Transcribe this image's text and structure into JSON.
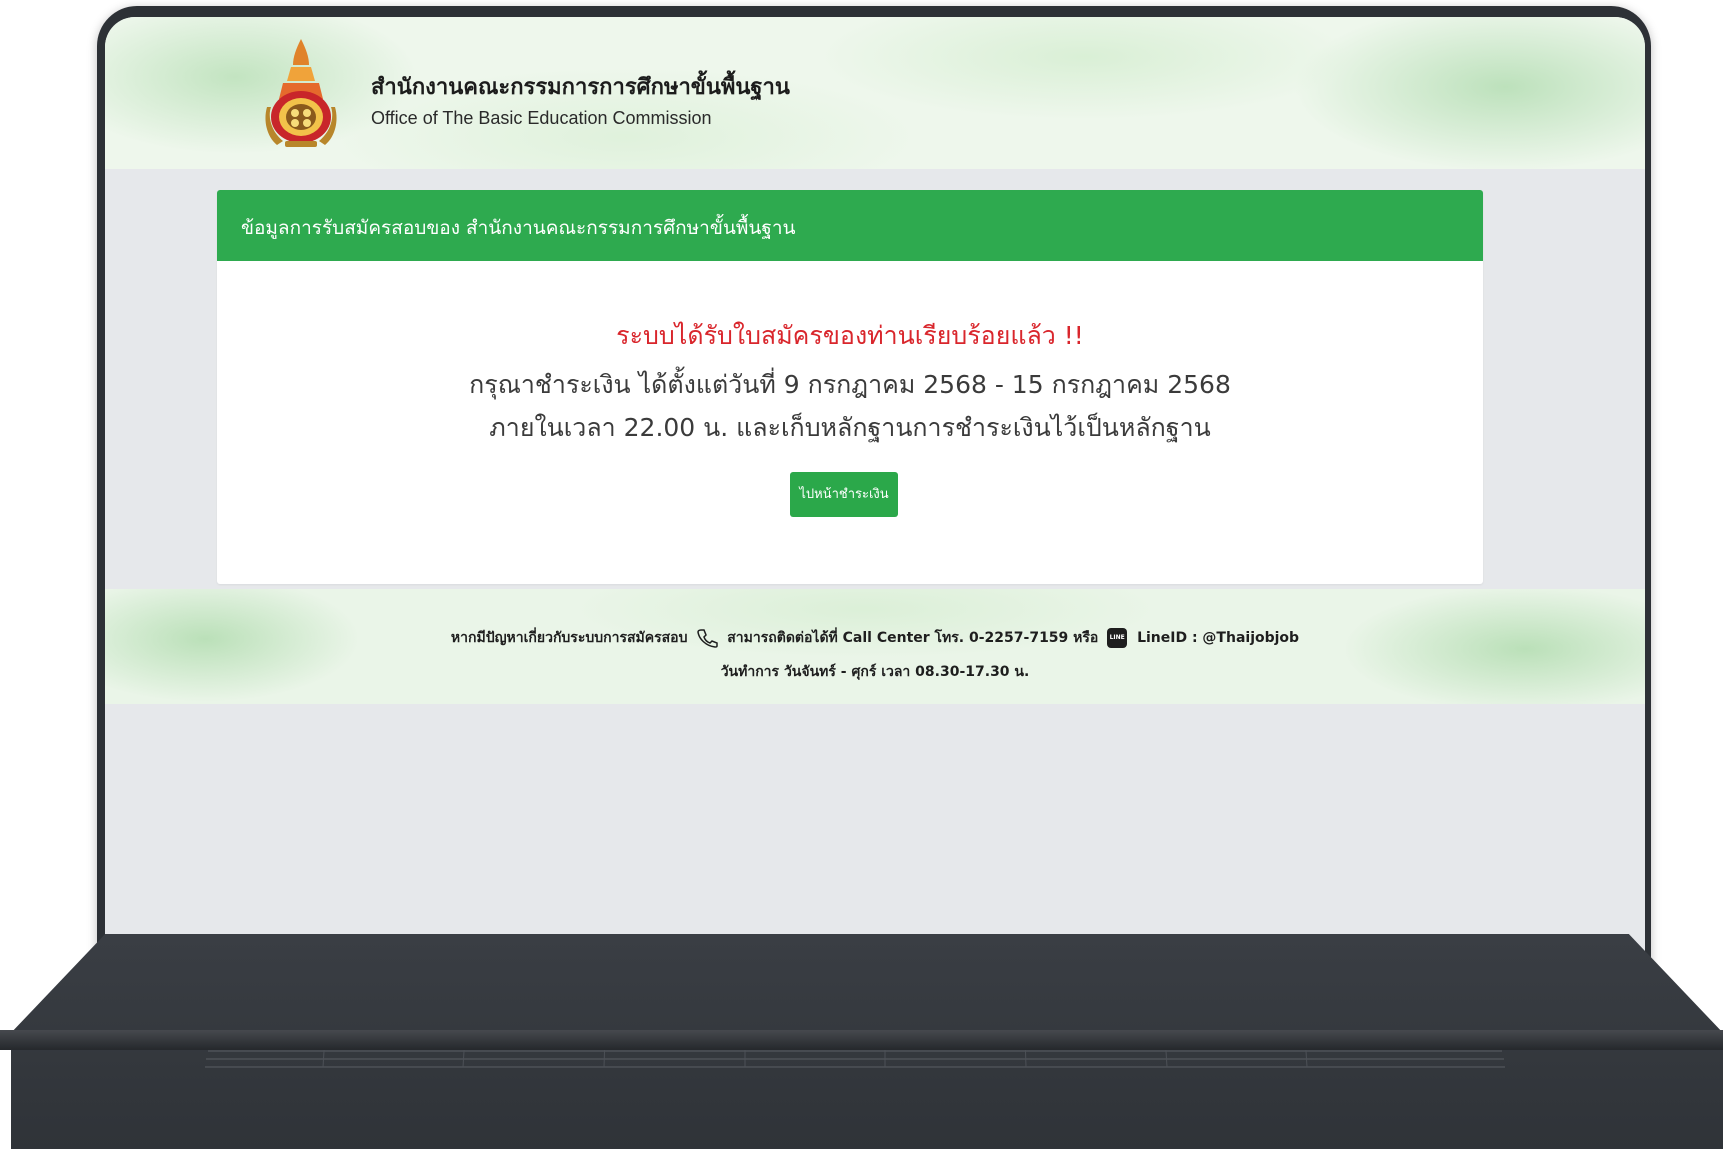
{
  "header": {
    "org_name_th": "สำนักงานคณะกรรมการการศึกษาขั้นพื้นฐาน",
    "org_name_en": "Office of The Basic Education Commission"
  },
  "card": {
    "title": "ข้อมูลการรับสมัครสอบของ สำนักงานคณะกรรมการศึกษาขั้นพื้นฐาน",
    "success_message": "ระบบได้รับใบสมัครของท่านเรียบร้อยแล้ว !!",
    "payment_period": "กรุณาชำระเงิน ได้ตั้งแต่วันที่ 9 กรกฎาคม 2568 - 15 กรกฎาคม 2568",
    "payment_deadline": "ภายในเวลา 22.00 น. และเก็บหลักฐานการชำระเงินไว้เป็นหลักฐาน",
    "pay_button_label": "ไปหน้าชำระเงิน"
  },
  "footer": {
    "problem_text": "หากมีปัญหาเกี่ยวกับระบบการสมัครสอบ",
    "contact_text": "สามารถติดต่อได้ที่ Call Center โทร. 0-2257-7159 หรือ",
    "line_id_text": "LineID : @Thaijobjob",
    "hours_text": "วันทำการ วันจันทร์ - ศุกร์ เวลา 08.30-17.30 น."
  },
  "icons": {
    "phone": "phone-icon",
    "line": "line-app-icon",
    "logo": "obec-emblem-logo"
  },
  "colors": {
    "header_green": "#2eaa4f",
    "button_green": "#2ba84a",
    "alert_red": "#d9262c",
    "bezel": "#2d3136"
  }
}
